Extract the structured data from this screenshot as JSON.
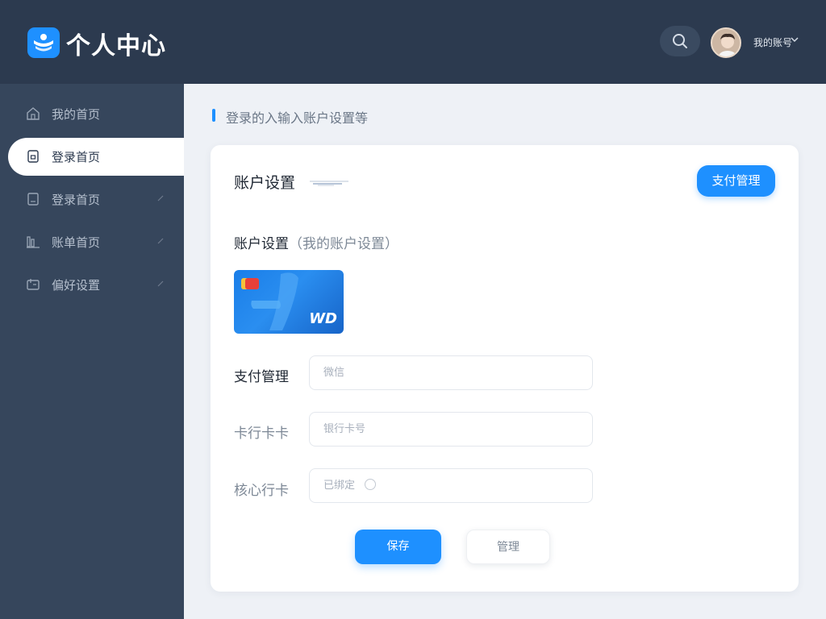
{
  "header": {
    "app_title": "个人中心",
    "username": "我的账号",
    "logo_icon": "app-logo-icon",
    "search_icon": "search-icon",
    "chevron_icon": "chevron-down-icon"
  },
  "sidebar": {
    "items": [
      {
        "label": "我的首页",
        "icon": "home-icon",
        "active": false
      },
      {
        "label": "登录首页",
        "icon": "lock-icon",
        "active": true
      },
      {
        "label": "登录首页",
        "icon": "document-icon",
        "active": false
      },
      {
        "label": "账单首页",
        "icon": "chart-icon",
        "active": false
      },
      {
        "label": "偏好设置",
        "icon": "wallet-icon",
        "active": false
      }
    ]
  },
  "breadcrumb": {
    "text": "登录的入输入账户设置等"
  },
  "card": {
    "title": "账户设置",
    "pay_button": "支付管理",
    "section_title": "账户设置",
    "section_subtitle": "（我的账户设置）",
    "bank_card_brand": "WD",
    "fields": [
      {
        "label": "支付管理",
        "value": "微信"
      },
      {
        "label": "卡行卡卡",
        "value": "银行卡号"
      },
      {
        "label": "核心行卡",
        "value": "已绑定"
      }
    ],
    "confirm_button": "保存",
    "cancel_button": "管理"
  },
  "colors": {
    "header_bg": "#2c3a4f",
    "sidebar_bg": "#36465c",
    "accent": "#1e90ff",
    "page_bg": "#eef1f6"
  }
}
